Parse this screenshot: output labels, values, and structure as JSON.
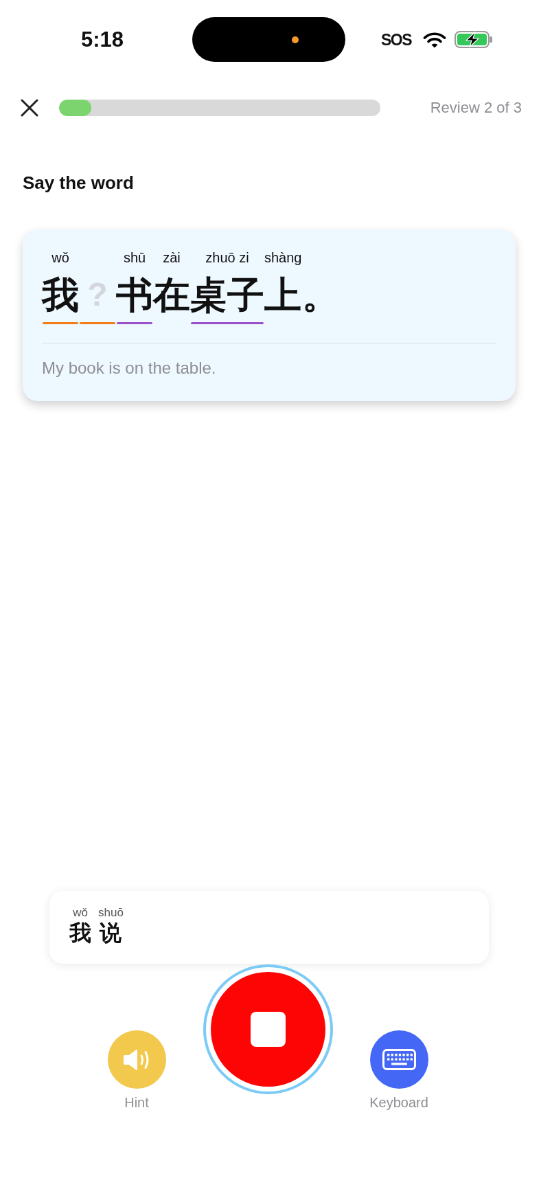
{
  "status_bar": {
    "time": "5:18",
    "network": "SOS",
    "charging": true
  },
  "header": {
    "progress": {
      "level": 0.1
    },
    "counter": "Review 2 of 3"
  },
  "prompt": "Say the word",
  "sentence_card": {
    "words": [
      {
        "kind": "word",
        "text": "我",
        "pinyin": "wǒ",
        "color": "#f27d16"
      },
      {
        "kind": "blank",
        "text": "?",
        "color": "#f27d16"
      },
      {
        "kind": "word",
        "text": "书",
        "pinyin": "shū",
        "color": "#9b52c8"
      },
      {
        "kind": "word",
        "text": "在",
        "pinyin": "zài"
      },
      {
        "kind": "word",
        "text": "桌子",
        "pinyin": "zhuō zi",
        "color": "#9b52c8"
      },
      {
        "kind": "word",
        "text": "上",
        "pinyin": "shàng"
      },
      {
        "kind": "punct",
        "text": "。"
      }
    ],
    "translation": "My book is on the table."
  },
  "answer_card": {
    "words": [
      {
        "text": "我",
        "pinyin": "wǒ"
      },
      {
        "text": "说",
        "pinyin": "shuō"
      }
    ]
  },
  "controls": [
    {
      "kind": "hint",
      "label": "Hint"
    },
    {
      "kind": "record",
      "recording": true
    },
    {
      "kind": "keyboard",
      "label": "Keyboard"
    }
  ]
}
